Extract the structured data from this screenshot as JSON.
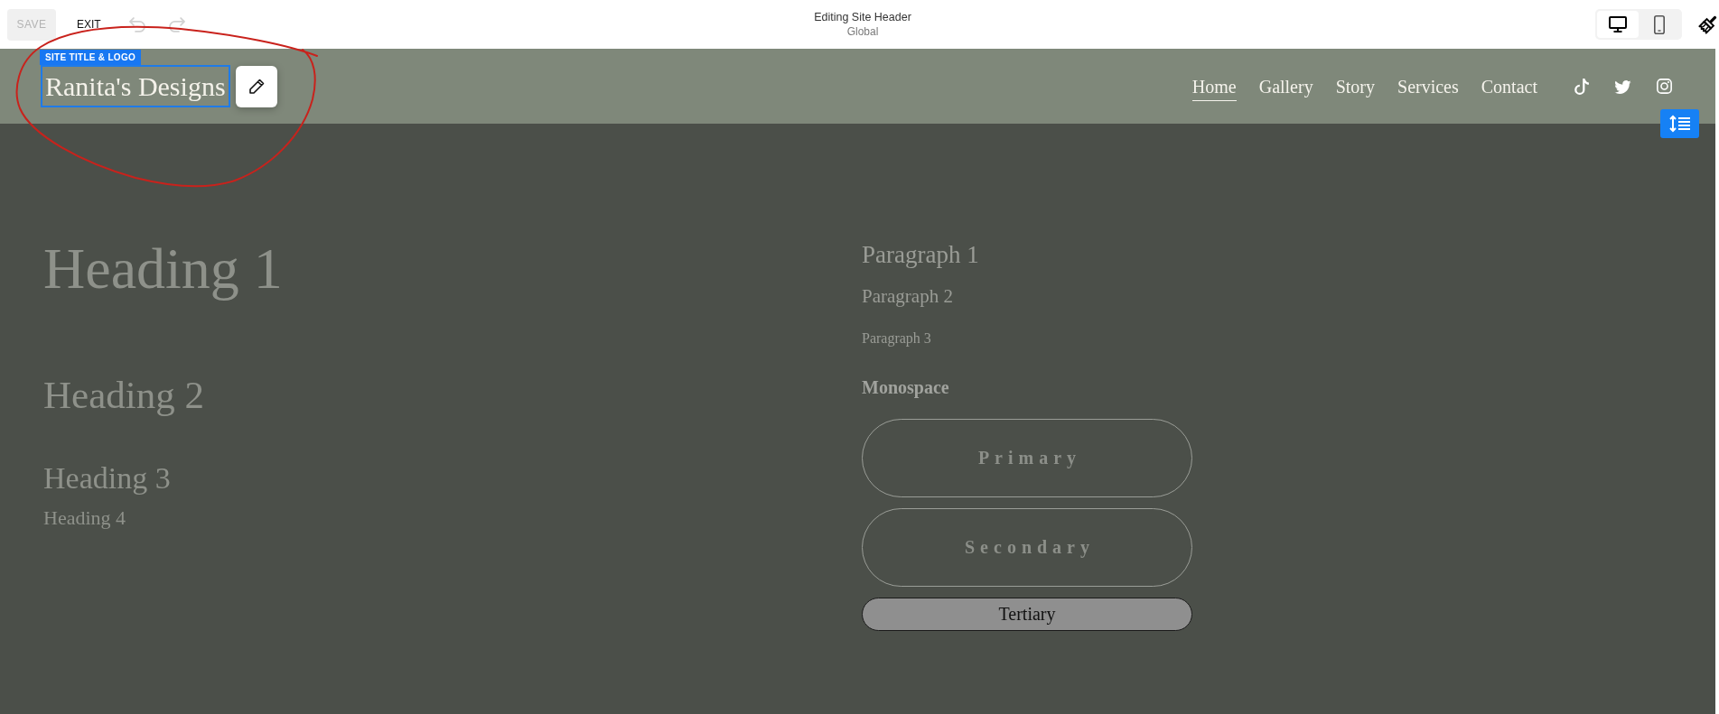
{
  "toolbar": {
    "save": {
      "label": "SAVE",
      "disabled": true
    },
    "exit": {
      "label": "EXIT"
    },
    "undo": {
      "disabled": true
    },
    "redo": {
      "disabled": true
    },
    "title": "Editing Site Header",
    "subtitle": "Global",
    "devices": [
      {
        "kind": "desktop",
        "selected": true
      },
      {
        "kind": "mobile",
        "selected": false
      }
    ]
  },
  "header": {
    "selection_label": "SITE TITLE & LOGO",
    "site_title": {
      "text": "Ranita's Designs",
      "selected": true
    },
    "nav": [
      {
        "label": "Home",
        "selected": true
      },
      {
        "label": "Gallery",
        "selected": false
      },
      {
        "label": "Story",
        "selected": false
      },
      {
        "label": "Services",
        "selected": false
      },
      {
        "label": "Contact",
        "selected": false
      }
    ],
    "social": [
      {
        "kind": "note"
      },
      {
        "kind": "bird"
      },
      {
        "kind": "camera"
      }
    ]
  },
  "content": {
    "headings": [
      "Heading 1",
      "Heading 2",
      "Heading 3",
      "Heading 4"
    ],
    "paragraphs": [
      "Paragraph 1",
      "Paragraph 2",
      "Paragraph 3"
    ],
    "monospace": "Monospace",
    "buttons": [
      {
        "label": "Primary",
        "kind": "primary"
      },
      {
        "label": "Secondary",
        "kind": "secondary"
      },
      {
        "label": "Tertiary",
        "kind": "tertiary"
      }
    ]
  }
}
